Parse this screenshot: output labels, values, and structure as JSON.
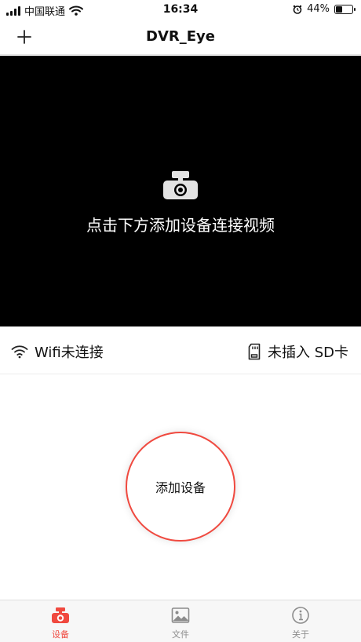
{
  "status_bar": {
    "carrier": "中国联通",
    "time": "16:34",
    "battery_percent": "44%",
    "battery_level": 0.44
  },
  "navbar": {
    "title": "DVR_Eye",
    "add_icon": "plus-icon"
  },
  "video": {
    "icon": "camera-icon",
    "message": "点击下方添加设备连接视频"
  },
  "info_bar": {
    "wifi_label": "Wifi未连接",
    "wifi_icon": "wifi-icon",
    "sd_label": "未插入 SD卡",
    "sd_icon": "sd-card-icon"
  },
  "main": {
    "add_device_label": "添加设备"
  },
  "tabbar": {
    "active_color": "#f0493f",
    "inactive_color": "#8c8c8c",
    "tabs": [
      {
        "label": "设备",
        "icon": "dashcam-icon",
        "active": true
      },
      {
        "label": "文件",
        "icon": "image-icon",
        "active": false
      },
      {
        "label": "关于",
        "icon": "info-icon",
        "active": false
      }
    ]
  }
}
